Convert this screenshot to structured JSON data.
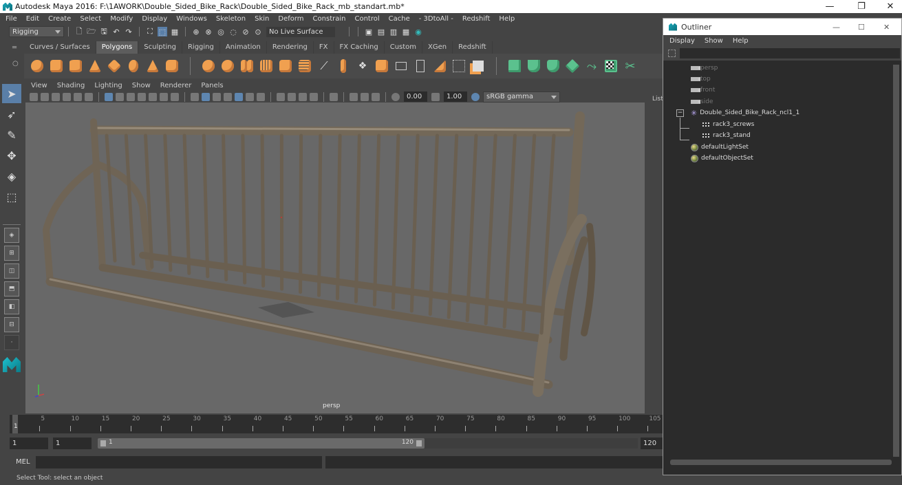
{
  "window": {
    "title": "Autodesk Maya 2016: F:\\1AWORK\\Double_Sided_Bike_Rack\\Double_Sided_Bike_Rack_mb_standart.mb*",
    "controls": {
      "minimize": "—",
      "restore": "❐",
      "close": "✕"
    }
  },
  "menubar": [
    "File",
    "Edit",
    "Create",
    "Select",
    "Modify",
    "Display",
    "Windows",
    "Skeleton",
    "Skin",
    "Deform",
    "Constrain",
    "Control",
    "Cache",
    "- 3DtoAll -",
    "Redshift",
    "Help"
  ],
  "statusline": {
    "menuset": "Rigging",
    "live_surface": "No Live Surface"
  },
  "shelf": {
    "tabs": [
      "Curves / Surfaces",
      "Polygons",
      "Sculpting",
      "Rigging",
      "Animation",
      "Rendering",
      "FX",
      "FX Caching",
      "Custom",
      "XGen",
      "Redshift"
    ],
    "active_tab": "Polygons",
    "icons": [
      "poly-sphere-icon",
      "poly-cube-icon",
      "poly-cylinder-icon",
      "poly-cone-icon",
      "poly-plane-icon",
      "poly-torus-icon",
      "poly-pyramid-icon",
      "poly-pipe-icon",
      "combine-icon",
      "separate-icon",
      "extract-icon",
      "smooth-icon",
      "mirror-icon",
      "bevel-icon",
      "bridge-icon",
      "multicut-icon",
      "extrude-icon",
      "append-icon",
      "fill-hole-icon",
      "insert-edge-loop-icon",
      "offset-loop-icon",
      "target-weld-icon",
      "merge-icon",
      "planar-uv-icon",
      "cylindrical-uv-icon",
      "spherical-uv-icon",
      "automatic-uv-icon",
      "unfold-uv-icon",
      "uv-editor-icon",
      "cut-uv-icon"
    ]
  },
  "toolbox": [
    "select-tool-icon",
    "lasso-tool-icon",
    "paint-select-icon",
    "move-tool-icon",
    "rotate-tool-icon",
    "scale-tool-icon"
  ],
  "viewport": {
    "menus": [
      "View",
      "Shading",
      "Lighting",
      "Show",
      "Renderer",
      "Panels"
    ],
    "exposure": "0.00",
    "gamma": "1.00",
    "color_space": "sRGB gamma",
    "camera": "persp",
    "side_label": "List"
  },
  "timeline": {
    "ticks": [
      5,
      10,
      15,
      20,
      25,
      30,
      35,
      40,
      45,
      50,
      55,
      60,
      65,
      70,
      75,
      80,
      85,
      90,
      95,
      100,
      105
    ],
    "current_frame": "1",
    "start": "1",
    "range_start": "1",
    "range_slider_start": "1",
    "range_slider_end": "120",
    "range_end": "120"
  },
  "commandline": {
    "label": "MEL"
  },
  "helpline": "Select Tool: select an object",
  "outliner": {
    "title": "Outliner",
    "menus": [
      "Display",
      "Show",
      "Help"
    ],
    "items": [
      {
        "label": "persp",
        "type": "camera",
        "dim": true
      },
      {
        "label": "top",
        "type": "camera",
        "dim": true
      },
      {
        "label": "front",
        "type": "camera",
        "dim": true
      },
      {
        "label": "side",
        "type": "camera",
        "dim": true
      },
      {
        "label": "Double_Sided_Bike_Rack_ncl1_1",
        "type": "group"
      },
      {
        "label": "rack3_screws",
        "type": "mesh"
      },
      {
        "label": "rack3_stand",
        "type": "mesh"
      },
      {
        "label": "defaultLightSet",
        "type": "set"
      },
      {
        "label": "defaultObjectSet",
        "type": "set"
      }
    ]
  },
  "colors": {
    "ui_bg": "#444444",
    "viewport_bg": "#686868",
    "shelf_orange": "#f0a050",
    "shelf_green": "#5bc18e",
    "selection_blue": "#5a7fa8"
  }
}
